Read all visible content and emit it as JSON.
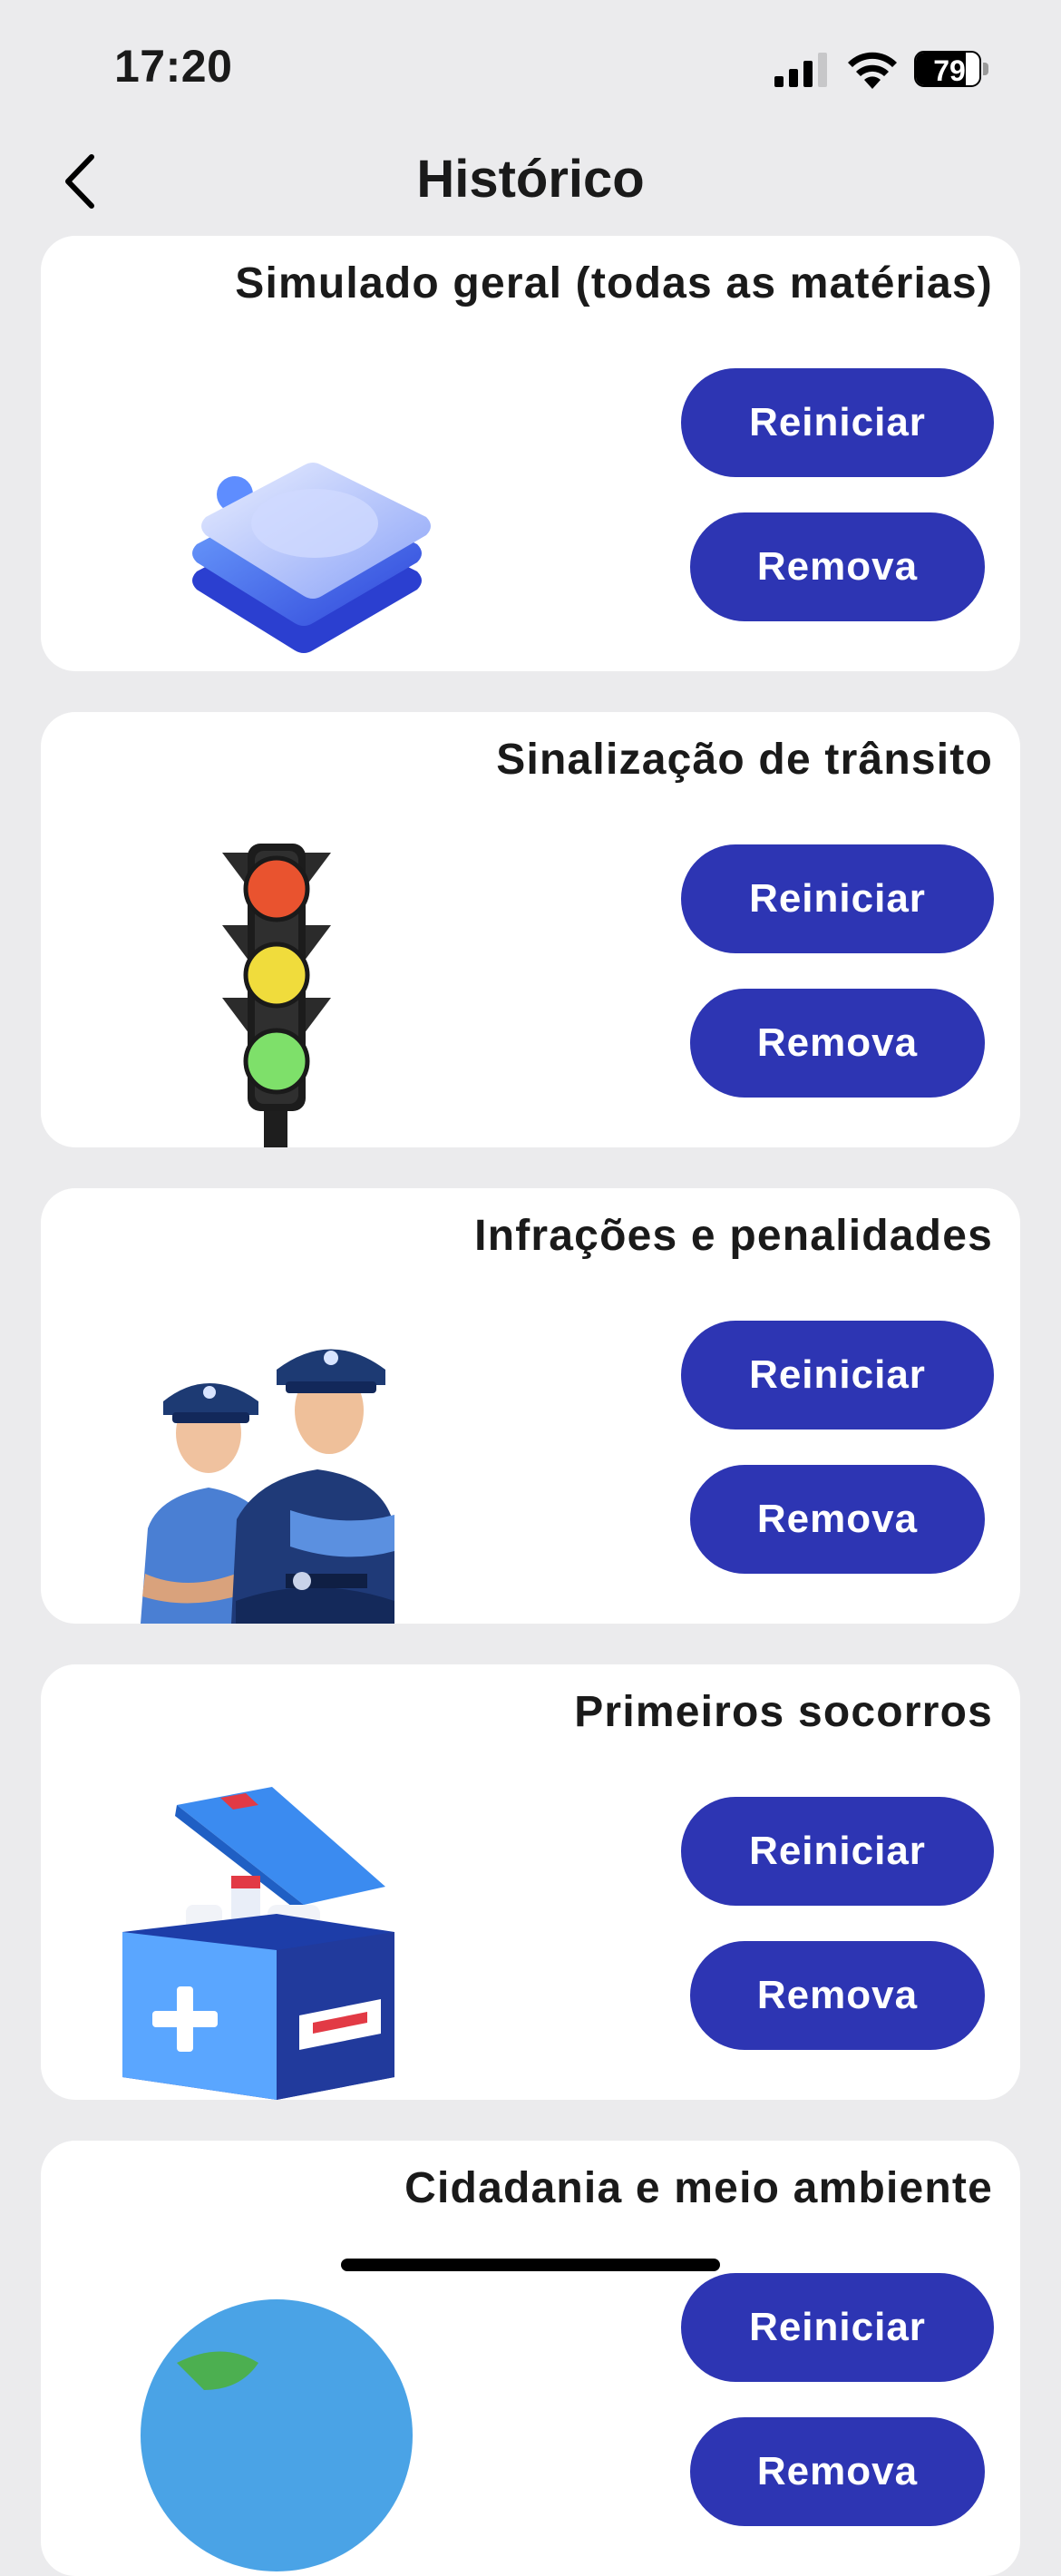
{
  "status_bar": {
    "time": "17:20",
    "battery": "79",
    "battery_level": 0.79
  },
  "nav": {
    "title": "Histórico",
    "back_icon": "chevron-left-icon"
  },
  "cards": [
    {
      "title": "Simulado geral (todas as matérias)",
      "reset_label": "Reiniciar",
      "remove_label": "Remova",
      "icon": "stacked-layers-icon"
    },
    {
      "title": "Sinalização de trânsito",
      "reset_label": "Reiniciar",
      "remove_label": "Remova",
      "icon": "traffic-light-icon"
    },
    {
      "title": "Infrações e penalidades",
      "reset_label": "Reiniciar",
      "remove_label": "Remova",
      "icon": "police-officers-icon"
    },
    {
      "title": "Primeiros socorros",
      "reset_label": "Reiniciar",
      "remove_label": "Remova",
      "icon": "first-aid-kit-icon"
    },
    {
      "title": "Cidadania e meio ambiente",
      "reset_label": "Reiniciar",
      "remove_label": "Remova",
      "icon": "globe-icon"
    }
  ],
  "colors": {
    "background": "#ebebed",
    "card": "#ffffff",
    "button": "#2d35b3",
    "button_text": "#ffffff"
  }
}
